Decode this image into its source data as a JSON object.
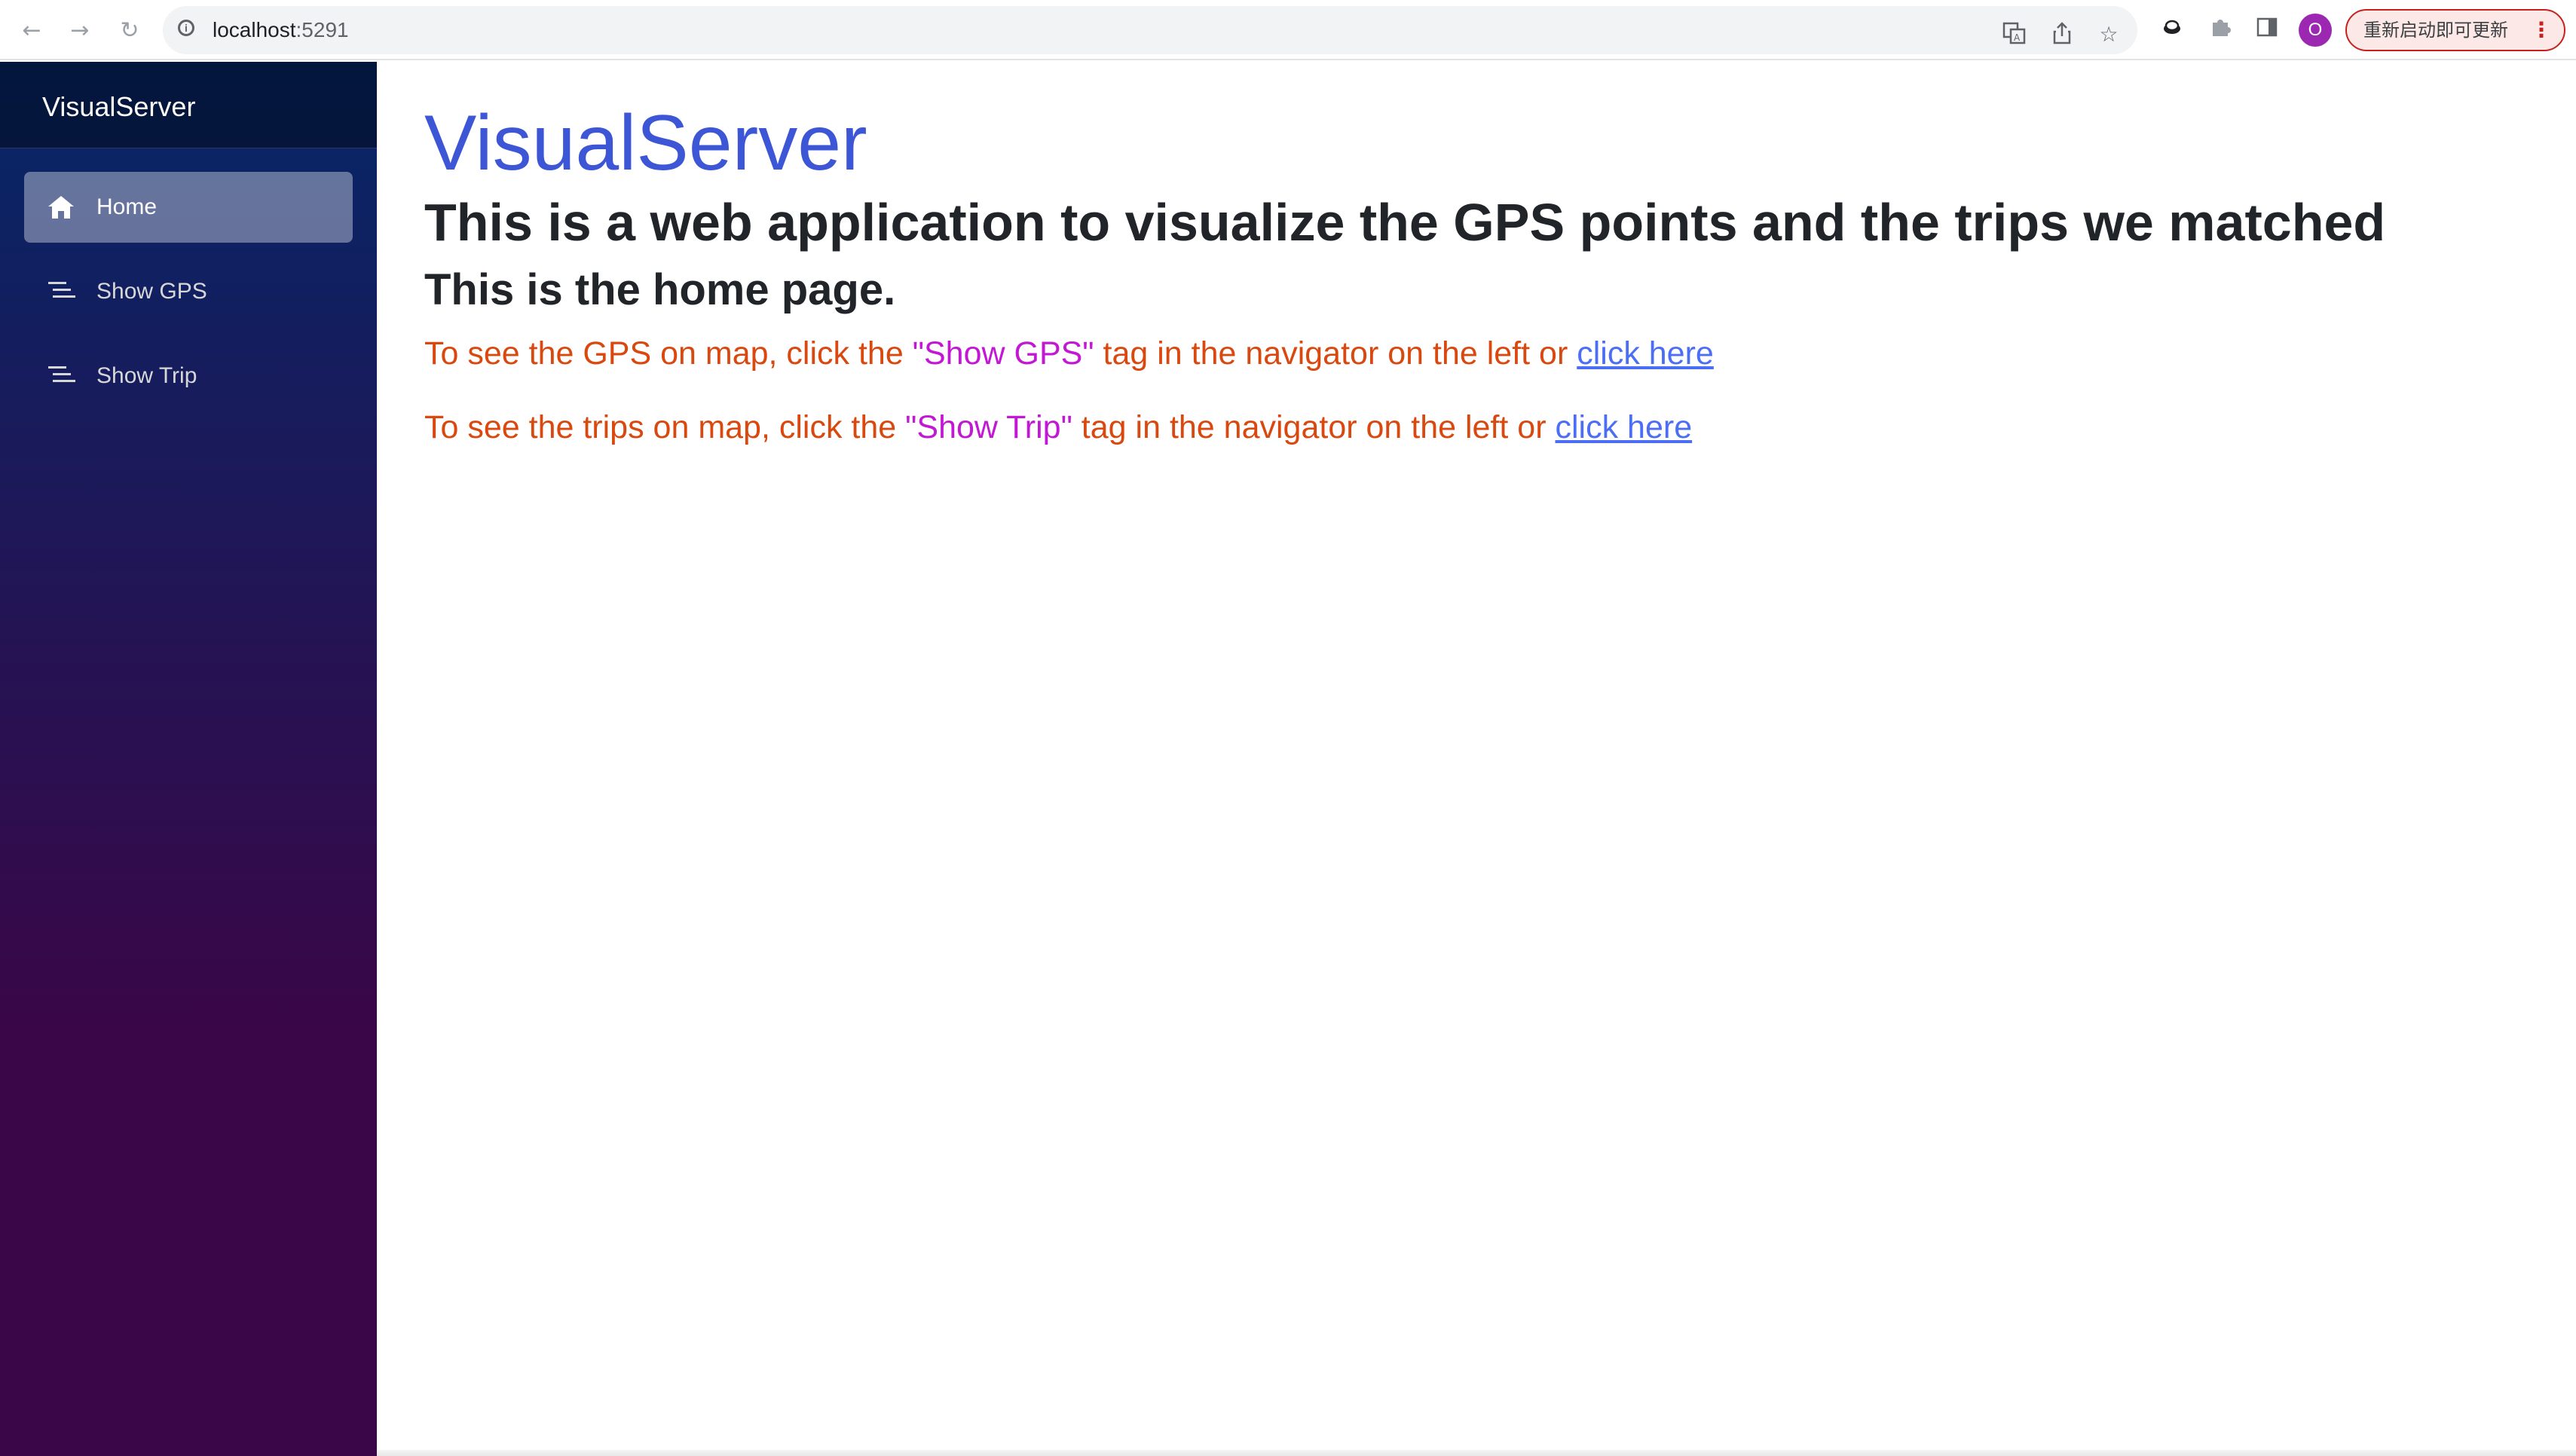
{
  "browser": {
    "url_host": "localhost",
    "url_port": ":5291",
    "profile_initial": "O",
    "update_label": "重新启动即可更新",
    "update_menu_glyph": "⋮",
    "icons": [
      "back-arrow-icon",
      "forward-arrow-icon",
      "reload-icon",
      "info-icon",
      "translate-icon",
      "share-icon",
      "bookmark-star-icon",
      "extension-icon",
      "puzzle-icon",
      "side-panel-icon",
      "profile-avatar",
      "menu-dots-icon"
    ]
  },
  "sidebar": {
    "brand": "VisualServer",
    "items": [
      {
        "label": "Home",
        "icon": "home-icon",
        "active": true
      },
      {
        "label": "Show GPS",
        "icon": "list-icon",
        "active": false
      },
      {
        "label": "Show Trip",
        "icon": "list-icon",
        "active": false
      }
    ]
  },
  "main": {
    "title": "VisualServer",
    "subtitle": "This is a web application to visualize the GPS points and the trips we matched",
    "page_heading": "This is the home page.",
    "gps_line": {
      "prefix": "To see the GPS on map, click the ",
      "tag": "\"Show GPS\"",
      "suffix": " tag in the navigator on the left or ",
      "link": "click here"
    },
    "trip_line": {
      "prefix": "To see the trips on map, click the ",
      "tag": "\"Show Trip\"",
      "suffix": " tag in the navigator on the left or ",
      "link": "click here"
    }
  },
  "colors": {
    "title": "#3c56d6",
    "instruction_text": "#d9480f",
    "tag_highlight": "#c218d4",
    "link": "#4c6ef5",
    "sidebar_top": "#052767",
    "sidebar_bottom": "#3a0647"
  }
}
